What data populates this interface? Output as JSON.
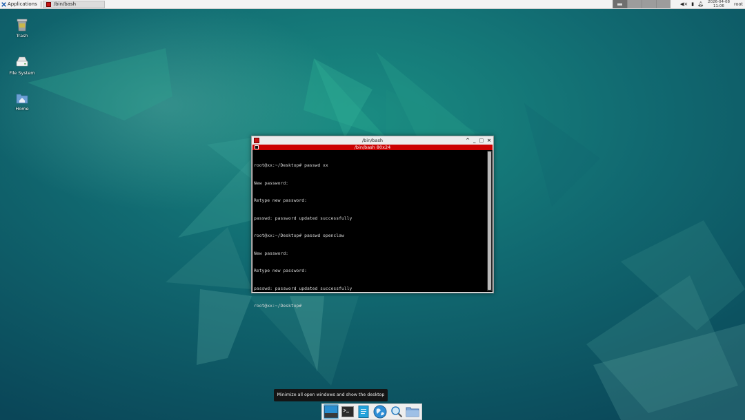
{
  "top_panel": {
    "apps_label": "Applications",
    "task_label": "/bin/bash",
    "clock_date": "2026-04-08",
    "clock_time": "11:06",
    "user": "root"
  },
  "desktop": {
    "icons": [
      {
        "label": "Trash",
        "icon": "trash-icon"
      },
      {
        "label": "File System",
        "icon": "drive-icon"
      },
      {
        "label": "Home",
        "icon": "home-folder-icon"
      }
    ]
  },
  "terminal": {
    "window_title": "/bin/bash",
    "tab_title": "/bin/bash 80x24",
    "controls": [
      "^",
      "_",
      "□",
      "×"
    ],
    "lines": [
      "root@xx:~/Desktop# passwd xx",
      "New password:",
      "Retype new password:",
      "passwd: password updated successfully",
      "root@xx:~/Desktop# passwd openclaw",
      "New password:",
      "Retype new password:",
      "passwd: password updated successfully",
      "root@xx:~/Desktop#"
    ]
  },
  "tooltip": {
    "text": "Minimize all open windows and show the desktop"
  },
  "dock": {
    "items": [
      "show-desktop-icon",
      "terminal-icon",
      "text-editor-icon",
      "web-browser-icon",
      "search-icon",
      "file-manager-icon"
    ]
  },
  "colors": {
    "terminal_tab_bar": "#cc0000",
    "desktop_base": "#0d5a66"
  }
}
